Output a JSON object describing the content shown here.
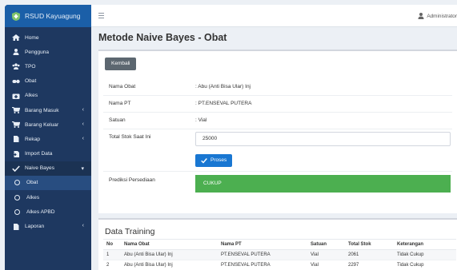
{
  "app": {
    "brand": "RSUD Kayuagung"
  },
  "sidebar": {
    "items": [
      {
        "label": "Home",
        "icon": "home-icon"
      },
      {
        "label": "Pengguna",
        "icon": "user-icon"
      },
      {
        "label": "TPO",
        "icon": "users-icon"
      },
      {
        "label": "Obat",
        "icon": "pills-icon"
      },
      {
        "label": "Alkes",
        "icon": "kit-icon"
      },
      {
        "label": "Barang Masuk",
        "icon": "cart-icon",
        "chevron": "‹"
      },
      {
        "label": "Barang Keluar",
        "icon": "cart-icon",
        "chevron": "‹"
      },
      {
        "label": "Rekap",
        "icon": "file-icon",
        "chevron": "‹"
      },
      {
        "label": "Import Data",
        "icon": "import-icon"
      },
      {
        "label": "Naive Bayes",
        "icon": "check-icon",
        "chevron": "▾"
      },
      {
        "label": "Obat",
        "icon": "circle-icon"
      },
      {
        "label": "Alkes",
        "icon": "circle-icon"
      },
      {
        "label": "Alkes APBD",
        "icon": "circle-icon"
      },
      {
        "label": "Laporan",
        "icon": "file-icon",
        "chevron": "‹"
      }
    ]
  },
  "topbar": {
    "user": "Administrator"
  },
  "page": {
    "title": "Metode Naive Bayes - Obat"
  },
  "form": {
    "back_label": "Kembali",
    "nama_obat_label": "Nama Obat",
    "nama_obat_value": ": Abu (Anti Bisa Ular) Inj",
    "nama_pt_label": "Nama PT",
    "nama_pt_value": ": PT.ENSEVAL PUTERA",
    "satuan_label": "Satuan",
    "satuan_value": ": Vial",
    "stok_label": "Total Stok Saat Ini",
    "stok_value": "25000",
    "proses_label": "Proses",
    "prediksi_label": "Prediksi Persediaan",
    "prediksi_value": "CUKUP"
  },
  "training": {
    "title": "Data Training",
    "columns": [
      "No",
      "Nama Obat",
      "Nama PT",
      "Satuan",
      "Total Stok",
      "Keterangan"
    ],
    "rows": [
      [
        "1",
        "Abu (Anti Bisa Ular) Inj",
        "PT.ENSEVAL PUTERA",
        "Vial",
        "2061",
        "Tidak Cukup"
      ],
      [
        "2",
        "Abu (Anti Bisa Ular) Inj",
        "PT.ENSEVAL PUTERA",
        "Vial",
        "2297",
        "Tidak Cukup"
      ]
    ]
  },
  "colors": {
    "sidebar": "#1e3860",
    "brand": "#1b5fa8",
    "primary": "#1977d2",
    "success": "#4caf50"
  }
}
